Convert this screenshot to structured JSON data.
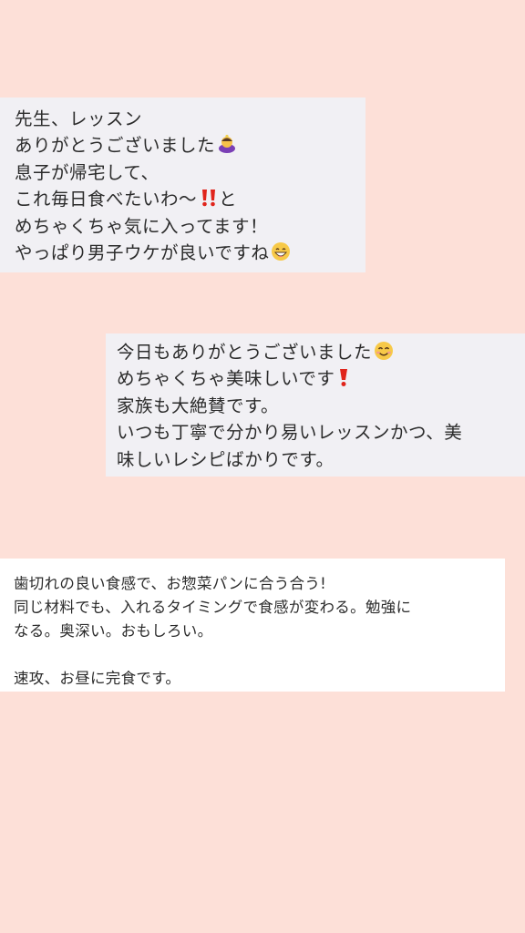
{
  "messages": [
    {
      "lines": [
        "先生、レッスン",
        "ありがとうございました",
        "息子が帰宅して、",
        "これ毎日食べたいわ〜",
        "めちゃくちゃ気に入ってます！",
        "やっぱり男子ウケが良いですね"
      ],
      "line4_suffix": "と",
      "icons": [
        "bowing-person-icon",
        "double-exclamation-icon",
        "grinning-face-icon"
      ]
    },
    {
      "lines": [
        "今日もありがとうございました",
        "めちゃくちゃ美味しいです",
        "家族も大絶賛です。",
        "いつも丁寧で分かり易いレッスンかつ、美",
        "味しいレシピばかりです。"
      ],
      "icons": [
        "smiling-face-icon",
        "heavy-exclamation-icon"
      ]
    },
    {
      "lines": [
        "歯切れの良い食感で、お惣菜パンに合う合う!",
        "同じ材料でも、入れるタイミングで食感が変わる。勉強に",
        "なる。奥深い。おもしろい。",
        "",
        "速攻、お昼に完食です。"
      ]
    }
  ]
}
